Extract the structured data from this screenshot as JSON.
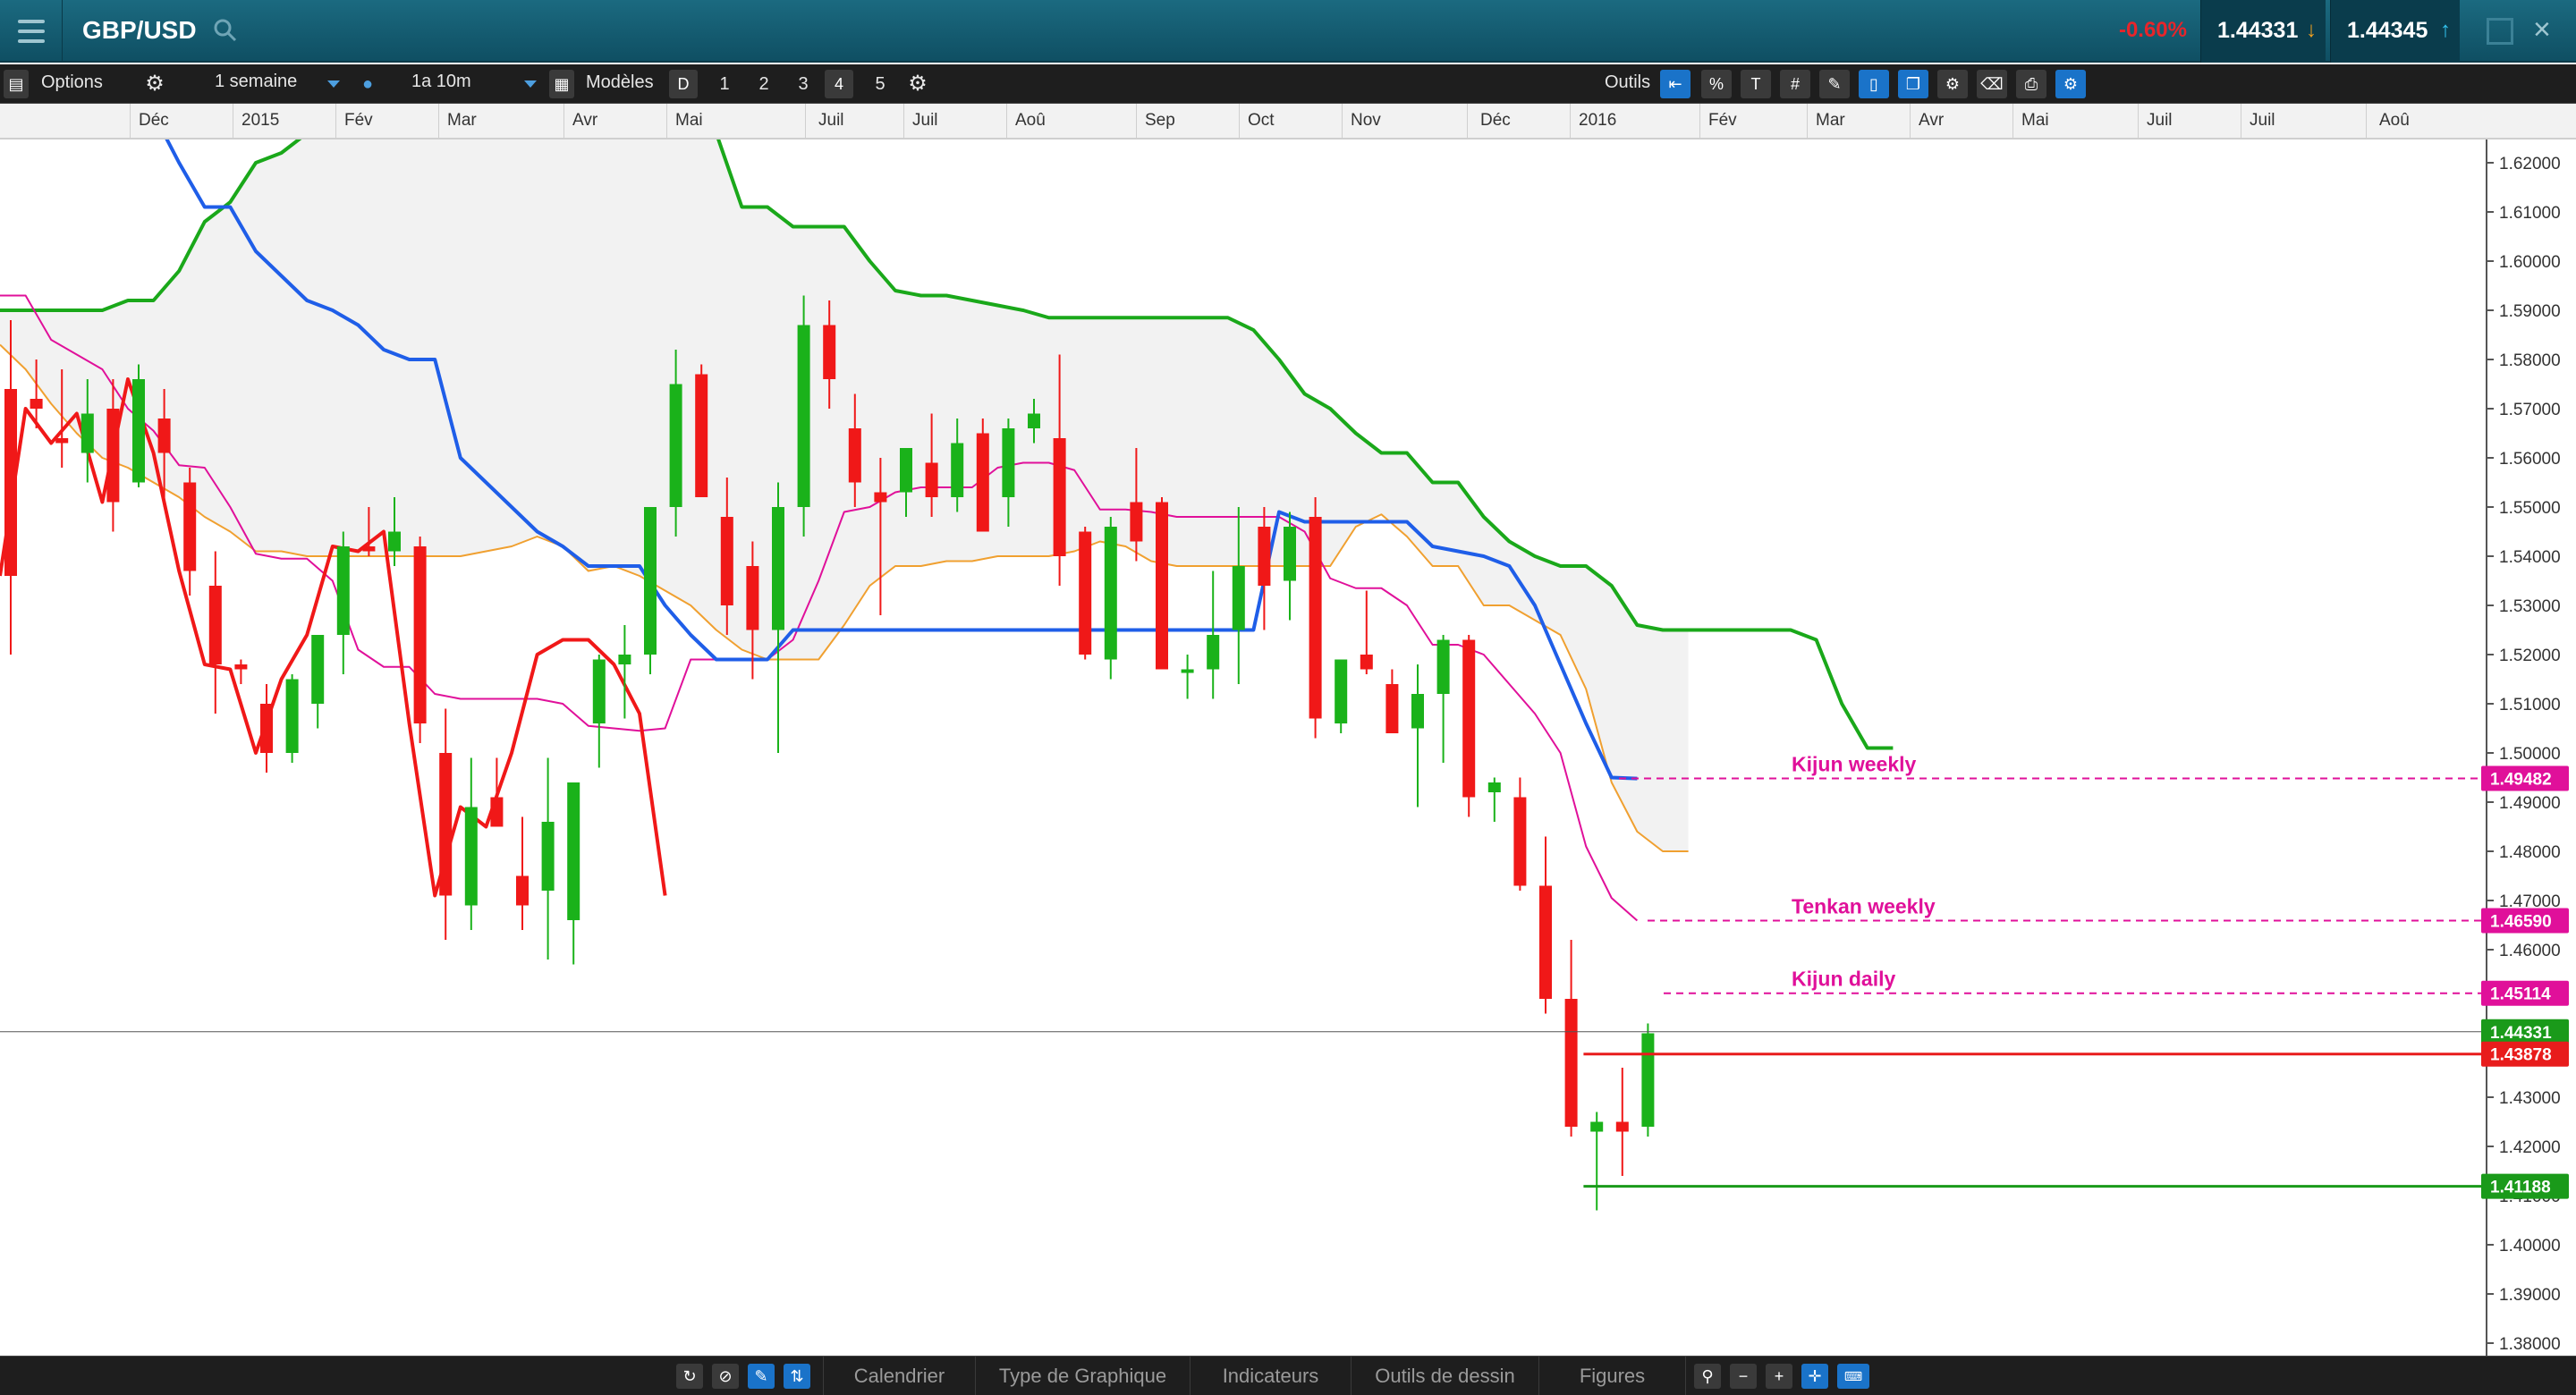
{
  "header": {
    "symbol": "GBP/USD",
    "change_pct": "-0.60%",
    "bid": "1.44331",
    "ask": "1.44345",
    "colors": {
      "bar": "#146176",
      "negative": "#e8252a",
      "bid_arrow": "#f0a020",
      "ask_arrow": "#33c4f0"
    },
    "icons": [
      "menu-icon",
      "search-icon",
      "popout-icon",
      "close-icon"
    ]
  },
  "toolbar": {
    "options_label": "Options",
    "interval": "1 semaine",
    "range": "1a 10m",
    "models_label": "Modèles",
    "tools_label": "Outils",
    "quick_intervals": [
      "D",
      "1",
      "2",
      "3",
      "4",
      "5"
    ]
  },
  "months": [
    "Déc",
    "2015",
    "Fév",
    "Mar",
    "Avr",
    "Mai",
    "Juil",
    "Juil",
    "Aoû",
    "Sep",
    "Oct",
    "Nov",
    "Déc",
    "2016",
    "Fév",
    "Mar",
    "Avr",
    "Mai",
    "Juil",
    "Juil",
    "Aoû"
  ],
  "bottom": {
    "tabs": [
      "Calendrier",
      "Type de Graphique",
      "Indicateurs",
      "Outils de dessin",
      "Figures"
    ]
  },
  "chart_data": {
    "type": "line",
    "instrument": "GBP/USD",
    "yticks": [
      1.62,
      1.61,
      1.6,
      1.59,
      1.58,
      1.57,
      1.56,
      1.55,
      1.54,
      1.53,
      1.52,
      1.51,
      1.5,
      1.49,
      1.48,
      1.47,
      1.46,
      1.45,
      1.44,
      1.43,
      1.42,
      1.41,
      1.4,
      1.39,
      1.38
    ],
    "ylim": [
      1.376,
      1.624
    ],
    "candles": [
      [
        1.574,
        1.588,
        1.52,
        1.536
      ],
      [
        1.572,
        1.58,
        1.566,
        1.57
      ],
      [
        1.564,
        1.578,
        1.558,
        1.563
      ],
      [
        1.561,
        1.576,
        1.555,
        1.569
      ],
      [
        1.57,
        1.576,
        1.545,
        1.551
      ],
      [
        1.555,
        1.579,
        1.554,
        1.576
      ],
      [
        1.568,
        1.574,
        1.55,
        1.561
      ],
      [
        1.555,
        1.558,
        1.532,
        1.537
      ],
      [
        1.534,
        1.541,
        1.508,
        1.518
      ],
      [
        1.518,
        1.519,
        1.514,
        1.517
      ],
      [
        1.51,
        1.514,
        1.496,
        1.5
      ],
      [
        1.5,
        1.516,
        1.498,
        1.515
      ],
      [
        1.51,
        1.523,
        1.505,
        1.524
      ],
      [
        1.524,
        1.545,
        1.516,
        1.542
      ],
      [
        1.542,
        1.55,
        1.54,
        1.541
      ],
      [
        1.541,
        1.552,
        1.538,
        1.545
      ],
      [
        1.542,
        1.544,
        1.502,
        1.506
      ],
      [
        1.5,
        1.509,
        1.462,
        1.471
      ],
      [
        1.469,
        1.499,
        1.464,
        1.489
      ],
      [
        1.491,
        1.499,
        1.489,
        1.485
      ],
      [
        1.475,
        1.487,
        1.464,
        1.469
      ],
      [
        1.472,
        1.499,
        1.458,
        1.486
      ],
      [
        1.466,
        1.49,
        1.457,
        1.494
      ],
      [
        1.506,
        1.52,
        1.497,
        1.519
      ],
      [
        1.518,
        1.526,
        1.507,
        1.52
      ],
      [
        1.52,
        1.544,
        1.516,
        1.55
      ],
      [
        1.55,
        1.582,
        1.544,
        1.575
      ],
      [
        1.577,
        1.579,
        1.559,
        1.552
      ],
      [
        1.548,
        1.556,
        1.524,
        1.53
      ],
      [
        1.538,
        1.543,
        1.515,
        1.525
      ],
      [
        1.525,
        1.555,
        1.5,
        1.55
      ],
      [
        1.55,
        1.593,
        1.544,
        1.587
      ],
      [
        1.587,
        1.592,
        1.57,
        1.576
      ],
      [
        1.566,
        1.573,
        1.55,
        1.555
      ],
      [
        1.553,
        1.56,
        1.528,
        1.551
      ],
      [
        1.553,
        1.562,
        1.548,
        1.562
      ],
      [
        1.559,
        1.569,
        1.548,
        1.552
      ],
      [
        1.552,
        1.568,
        1.549,
        1.563
      ],
      [
        1.565,
        1.568,
        1.545,
        1.545
      ],
      [
        1.552,
        1.568,
        1.546,
        1.566
      ],
      [
        1.566,
        1.572,
        1.563,
        1.569
      ],
      [
        1.564,
        1.581,
        1.534,
        1.54
      ],
      [
        1.545,
        1.546,
        1.519,
        1.52
      ],
      [
        1.519,
        1.548,
        1.515,
        1.546
      ],
      [
        1.551,
        1.562,
        1.539,
        1.543
      ],
      [
        1.551,
        1.552,
        1.521,
        1.517
      ],
      [
        1.517,
        1.52,
        1.511,
        1.517
      ],
      [
        1.517,
        1.537,
        1.511,
        1.524
      ],
      [
        1.525,
        1.55,
        1.514,
        1.538
      ],
      [
        1.546,
        1.55,
        1.525,
        1.534
      ],
      [
        1.535,
        1.549,
        1.527,
        1.546
      ],
      [
        1.548,
        1.552,
        1.503,
        1.507
      ],
      [
        1.506,
        1.515,
        1.504,
        1.519
      ],
      [
        1.52,
        1.533,
        1.516,
        1.517
      ],
      [
        1.514,
        1.517,
        1.504,
        1.504
      ],
      [
        1.505,
        1.518,
        1.489,
        1.512
      ],
      [
        1.512,
        1.524,
        1.498,
        1.523
      ],
      [
        1.523,
        1.524,
        1.487,
        1.491
      ],
      [
        1.492,
        1.495,
        1.486,
        1.494
      ],
      [
        1.491,
        1.495,
        1.472,
        1.473
      ],
      [
        1.473,
        1.483,
        1.447,
        1.45
      ],
      [
        1.45,
        1.462,
        1.422,
        1.424
      ],
      [
        1.423,
        1.427,
        1.407,
        1.425
      ],
      [
        1.425,
        1.436,
        1.414,
        1.423
      ],
      [
        1.424,
        1.445,
        1.422,
        1.443
      ]
    ],
    "tenkan": [
      1.593,
      1.593,
      1.584,
      1.581,
      1.578,
      1.57,
      1.5655,
      1.5585,
      1.558,
      1.55,
      1.5405,
      1.5395,
      1.5395,
      1.535,
      1.521,
      1.5175,
      1.5175,
      1.512,
      1.511,
      1.511,
      1.511,
      1.511,
      1.51,
      1.5055,
      1.505,
      1.5045,
      1.505,
      1.519,
      1.519,
      1.519,
      1.519,
      1.523,
      1.535,
      1.549,
      1.55,
      1.553,
      1.554,
      1.554,
      1.554,
      1.558,
      1.559,
      1.559,
      1.5575,
      1.5495,
      1.5495,
      1.549,
      1.548,
      1.548,
      1.548,
      1.548,
      1.548,
      1.545,
      1.5355,
      1.5335,
      1.5335,
      1.53,
      1.522,
      1.522,
      1.52,
      1.514,
      1.508,
      1.5,
      1.481,
      1.4705,
      1.4659
    ],
    "kijun": [
      1.63,
      1.63,
      1.63,
      1.63,
      1.63,
      1.63,
      1.63,
      1.62,
      1.611,
      1.611,
      1.602,
      1.597,
      1.592,
      1.59,
      1.587,
      1.582,
      1.58,
      1.58,
      1.56,
      1.555,
      1.55,
      1.545,
      1.542,
      1.538,
      1.538,
      1.538,
      1.53,
      1.524,
      1.519,
      1.519,
      1.519,
      1.525,
      1.525,
      1.525,
      1.525,
      1.525,
      1.525,
      1.525,
      1.525,
      1.525,
      1.525,
      1.525,
      1.525,
      1.525,
      1.525,
      1.525,
      1.525,
      1.525,
      1.525,
      1.525,
      1.549,
      1.547,
      1.547,
      1.547,
      1.547,
      1.547,
      1.542,
      1.541,
      1.54,
      1.538,
      1.53,
      1.518,
      1.506,
      1.495,
      1.4948
    ],
    "chikou": [
      1.536,
      1.57,
      1.563,
      1.569,
      1.551,
      1.576,
      1.561,
      1.537,
      1.518,
      1.517,
      1.5,
      1.515,
      1.524,
      1.542,
      1.541,
      1.545,
      1.506,
      1.471,
      1.489,
      1.485,
      1.5,
      1.52,
      1.523,
      1.523,
      1.518,
      1.508,
      1.471
    ],
    "span_a": [
      1.583,
      1.578,
      1.571,
      1.565,
      1.56,
      1.558,
      1.555,
      1.552,
      1.548,
      1.545,
      1.541,
      1.541,
      1.54,
      1.54,
      1.54,
      1.54,
      1.54,
      1.54,
      1.54,
      1.541,
      1.542,
      1.544,
      1.542,
      1.537,
      1.538,
      1.536,
      1.533,
      1.53,
      1.525,
      1.521,
      1.519,
      1.519,
      1.519,
      1.526,
      1.534,
      1.538,
      1.538,
      1.539,
      1.539,
      1.54,
      1.54,
      1.54,
      1.541,
      1.543,
      1.542,
      1.539,
      1.538,
      1.538,
      1.538,
      1.538,
      1.538,
      1.538,
      1.538,
      1.546,
      1.5485,
      1.544,
      1.538,
      1.538,
      1.53,
      1.53,
      1.527,
      1.524,
      1.513,
      1.494,
      1.484,
      1.48,
      1.48
    ],
    "span_b": [
      1.59,
      1.59,
      1.59,
      1.59,
      1.59,
      1.592,
      1.592,
      1.598,
      1.608,
      1.612,
      1.62,
      1.622,
      1.626,
      1.626,
      1.626,
      1.626,
      1.626,
      1.626,
      1.626,
      1.626,
      1.626,
      1.626,
      1.626,
      1.626,
      1.626,
      1.626,
      1.626,
      1.626,
      1.626,
      1.611,
      1.611,
      1.607,
      1.607,
      1.607,
      1.6,
      1.594,
      1.593,
      1.593,
      1.592,
      1.591,
      1.59,
      1.5885,
      1.5885,
      1.5885,
      1.5885,
      1.5885,
      1.5885,
      1.5885,
      1.5885,
      1.586,
      1.58,
      1.573,
      1.57,
      1.565,
      1.561,
      1.561,
      1.555,
      1.555,
      1.548,
      1.543,
      1.54,
      1.538,
      1.538,
      1.534,
      1.526,
      1.525,
      1.525,
      1.525,
      1.525,
      1.525,
      1.525,
      1.523,
      1.51,
      1.501,
      1.501
    ],
    "levels": [
      {
        "name": "Kijun weekly",
        "value": 1.49482,
        "label": "1.49482",
        "color": "#e0109a",
        "style": "dashed"
      },
      {
        "name": "Tenkan weekly",
        "value": 1.4659,
        "label": "1.46590",
        "color": "#e0109a",
        "style": "dashed"
      },
      {
        "name": "Kijun daily",
        "value": 1.45114,
        "label": "1.45114",
        "color": "#e0109a",
        "style": "dashed"
      },
      {
        "name": "",
        "value": 1.44331,
        "label": "1.44331",
        "color": "#1a9a1a",
        "style": "current"
      },
      {
        "name": "",
        "value": 1.43878,
        "label": "1.43878",
        "color": "#e81c1c",
        "style": "solid"
      },
      {
        "name": "",
        "value": 1.41188,
        "label": "1.41188",
        "color": "#1a9a1a",
        "style": "solid"
      }
    ],
    "colors": {
      "up": "#1ab21a",
      "down": "#f01818",
      "tenkan": "#e0109a",
      "kijun": "#1f5ee8",
      "chikou": "#f01818",
      "span_a": "#f0a030",
      "span_b": "#1aa81a",
      "cloud": "#f2f2f2"
    }
  }
}
